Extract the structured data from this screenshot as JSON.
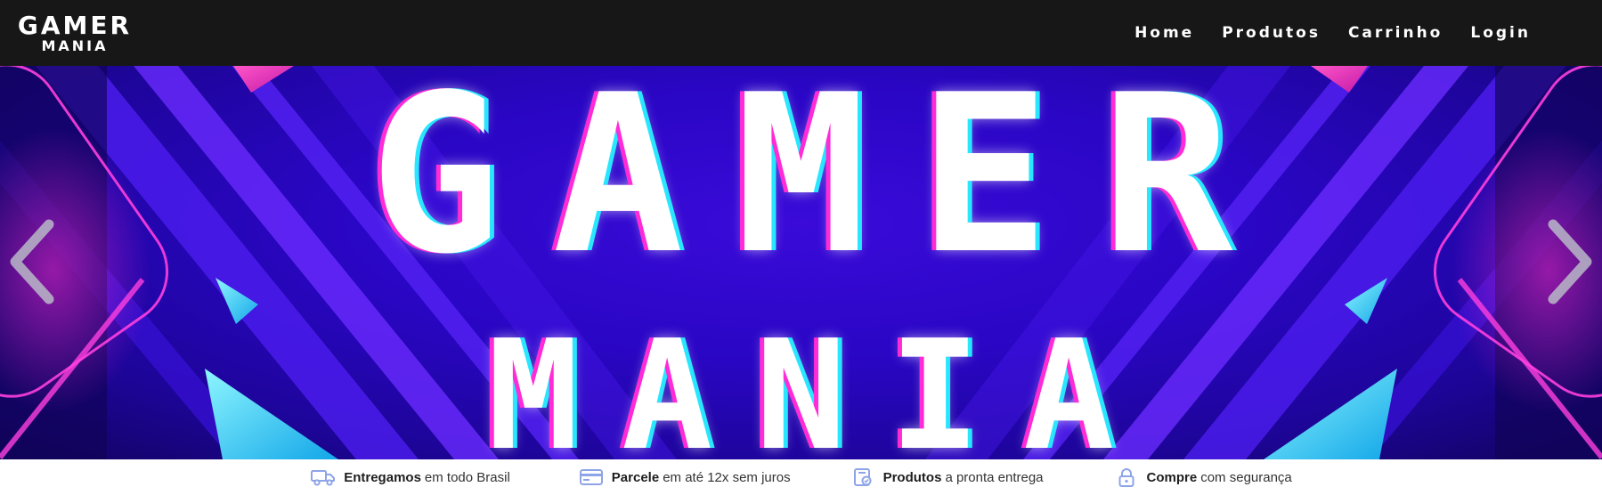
{
  "navbar": {
    "brand": {
      "top": "GAMER",
      "bottom": "MANIA"
    },
    "links": [
      "Home",
      "Produtos",
      "Carrinho",
      "Login"
    ]
  },
  "hero": {
    "line1": "GAMER",
    "line2": "MANIA",
    "prev_icon": "chevron-left-icon",
    "next_icon": "chevron-right-icon"
  },
  "features": [
    {
      "icon": "truck-icon",
      "bold": "Entregamos",
      "text": "em todo Brasil"
    },
    {
      "icon": "credit-card-icon",
      "bold": "Parcele",
      "text": "em até 12x sem juros"
    },
    {
      "icon": "package-check-icon",
      "bold": "Produtos",
      "text": "a pronta entrega"
    },
    {
      "icon": "lock-icon",
      "bold": "Compre",
      "text": "com segurança"
    }
  ],
  "colors": {
    "navbar_bg": "#171717",
    "hero_bg": "#2a06c5",
    "accent_magenta": "#ff2bd6",
    "accent_cyan": "#29e6ff",
    "feature_icon": "#8ea4e8"
  }
}
